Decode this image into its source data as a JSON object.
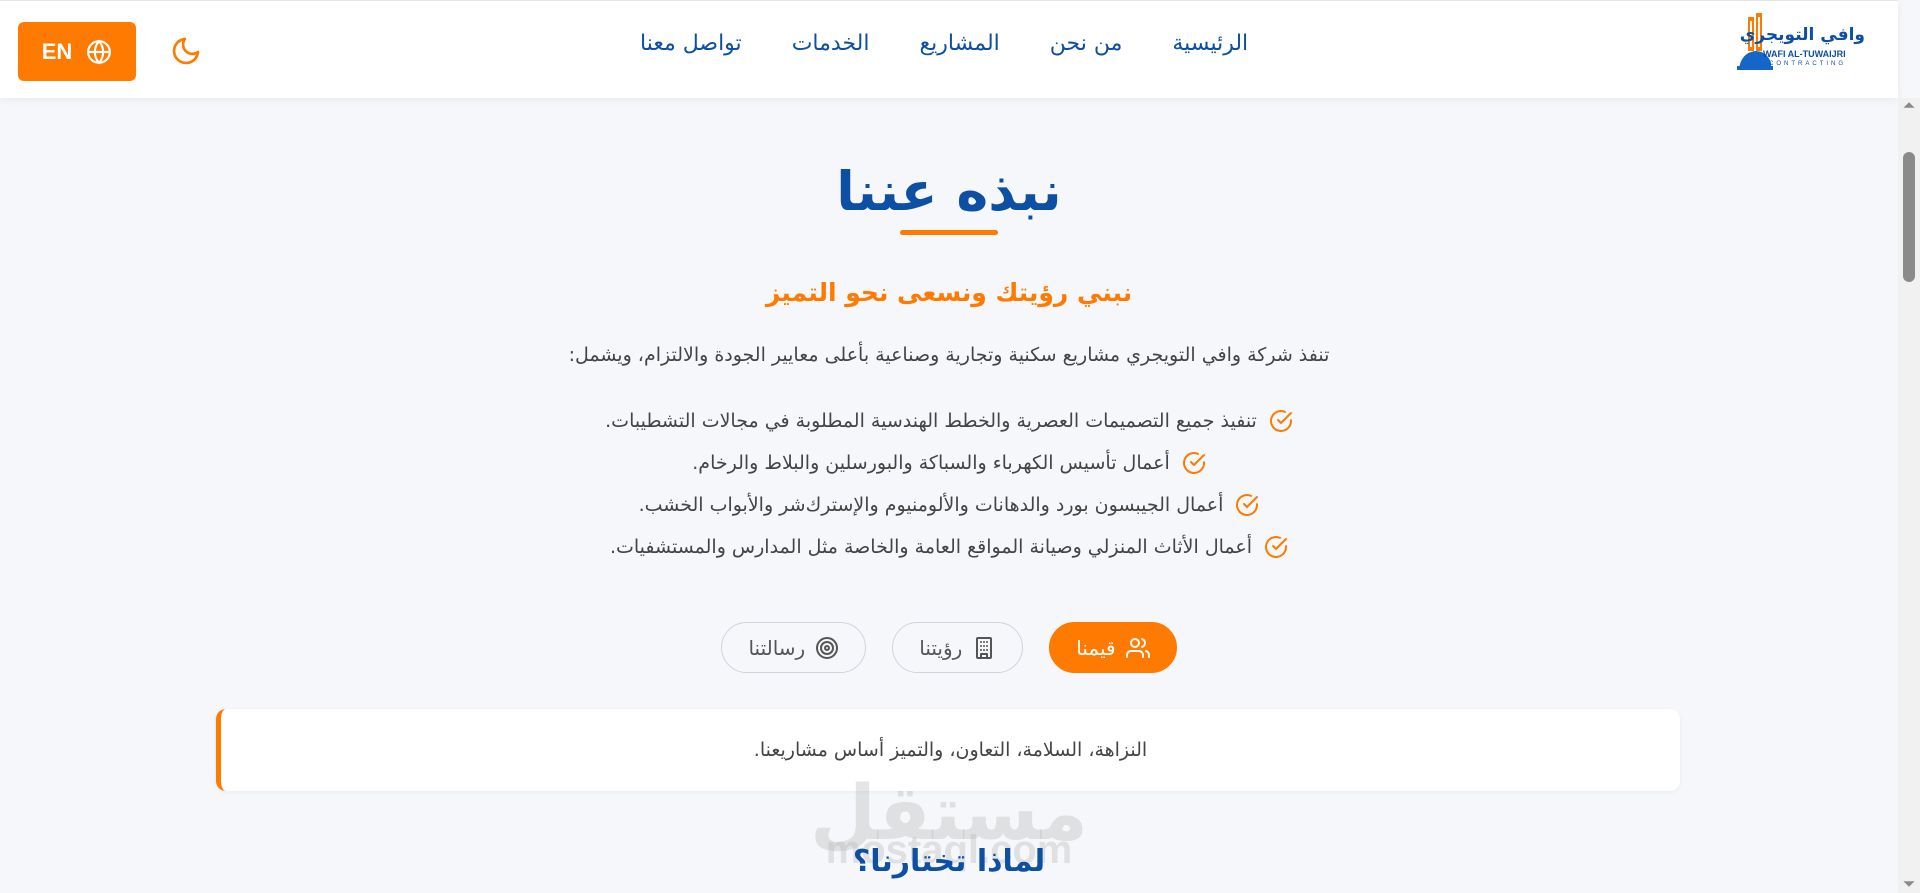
{
  "header": {
    "lang_label": "EN",
    "nav": [
      "الرئيسية",
      "من نحن",
      "المشاريع",
      "الخدمات",
      "تواصل معنا"
    ],
    "logo_ar": "وافي التويجري",
    "logo_en": "WAFI AL-TUWAIJRI",
    "logo_sub": "CONTRACTING"
  },
  "about": {
    "title": "نبذه عننا",
    "subtitle": "نبني رؤيتك ونسعى نحو التميز",
    "intro": "تنفذ شركة وافي التويجري مشاريع سكنية وتجارية وصناعية بأعلى معايير الجودة والالتزام، ويشمل:",
    "features": [
      "تنفيذ جميع التصميمات العصرية والخطط الهندسية المطلوبة في مجالات التشطيبات.",
      "أعمال تأسيس الكهرباء والسباكة والبورسلين والبلاط والرخام.",
      "أعمال الجيبسون بورد والدهانات والألومنيوم والإسترك‌شر والأبواب الخشب.",
      "أعمال الأثاث المنزلي وصيانة المواقع العامة والخاصة مثل المدارس والمستشفيات."
    ]
  },
  "tabs": {
    "values": "قيمنا",
    "vision": "رؤيتنا",
    "mission": "رسالتنا",
    "active": "values",
    "content": "النزاهة، السلامة، التعاون، والتميز أساس مشاريعنا."
  },
  "watermark": {
    "ar": "مستقل",
    "en": "mostaql.com"
  },
  "section2": {
    "title": "لماذا تختارنا؟"
  },
  "colors": {
    "primary": "#0d4fa3",
    "accent": "#ff7a00"
  }
}
